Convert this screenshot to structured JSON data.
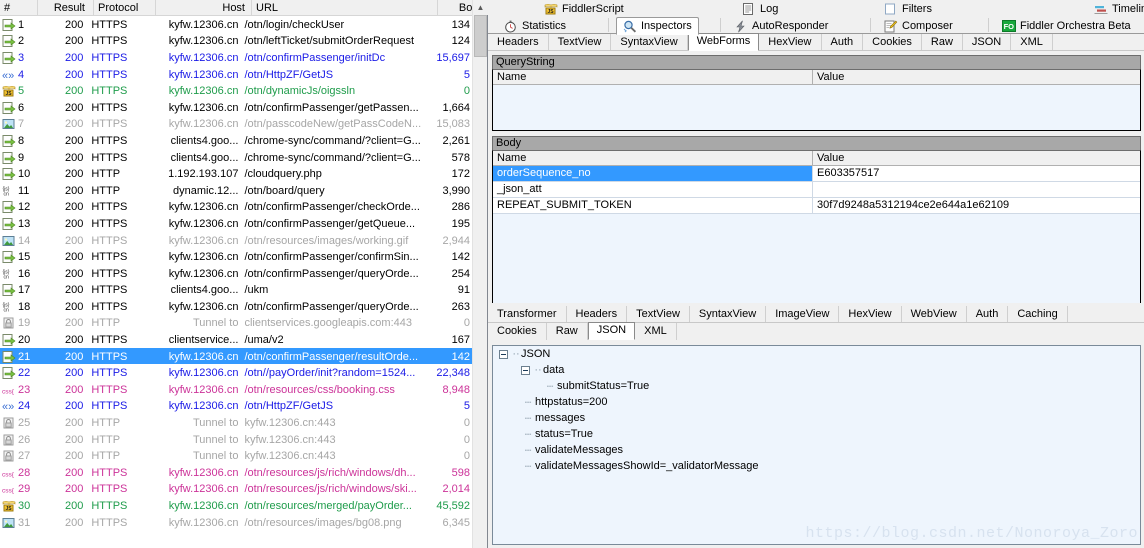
{
  "sessions": {
    "columns": [
      "#",
      "Result",
      "Protocol",
      "Host",
      "URL",
      "Body"
    ],
    "rows": [
      {
        "icon": "arrow-doc-icon",
        "num": "1",
        "result": "200",
        "protocol": "HTTPS",
        "host": "kyfw.12306.cn",
        "url": "/otn/login/checkUser",
        "body": "134",
        "style": "t-normal"
      },
      {
        "icon": "arrow-doc-icon",
        "num": "2",
        "result": "200",
        "protocol": "HTTPS",
        "host": "kyfw.12306.cn",
        "url": "/otn/leftTicket/submitOrderRequest",
        "body": "124",
        "style": "t-normal"
      },
      {
        "icon": "arrow-doc-icon",
        "num": "3",
        "result": "200",
        "protocol": "HTTPS",
        "host": "kyfw.12306.cn",
        "url": "/otn/confirmPassenger/initDc",
        "body": "15,697",
        "style": "t-blue"
      },
      {
        "icon": "angle-brackets-icon",
        "num": "4",
        "result": "200",
        "protocol": "HTTPS",
        "host": "kyfw.12306.cn",
        "url": "/otn/HttpZF/GetJS",
        "body": "5",
        "style": "t-blue"
      },
      {
        "icon": "js-script-icon",
        "num": "5",
        "result": "200",
        "protocol": "HTTPS",
        "host": "kyfw.12306.cn",
        "url": "/otn/dynamicJs/oigssln",
        "body": "0",
        "style": "t-green"
      },
      {
        "icon": "arrow-doc-icon",
        "num": "6",
        "result": "200",
        "protocol": "HTTPS",
        "host": "kyfw.12306.cn",
        "url": "/otn/confirmPassenger/getPassen...",
        "body": "1,664",
        "style": "t-normal"
      },
      {
        "icon": "image-icon",
        "num": "7",
        "result": "200",
        "protocol": "HTTPS",
        "host": "kyfw.12306.cn",
        "url": "/otn/passcodeNew/getPassCodeN...",
        "body": "15,083",
        "style": "t-gray"
      },
      {
        "icon": "arrow-doc-icon",
        "num": "8",
        "result": "200",
        "protocol": "HTTPS",
        "host": "clients4.goo...",
        "url": "/chrome-sync/command/?client=G...",
        "body": "2,261",
        "style": "t-normal"
      },
      {
        "icon": "arrow-doc-icon",
        "num": "9",
        "result": "200",
        "protocol": "HTTPS",
        "host": "clients4.goo...",
        "url": "/chrome-sync/command/?client=G...",
        "body": "578",
        "style": "t-normal"
      },
      {
        "icon": "arrow-doc-icon",
        "num": "10",
        "result": "200",
        "protocol": "HTTP",
        "host": "1.192.193.107",
        "url": "/cloudquery.php",
        "body": "172",
        "style": "t-normal"
      },
      {
        "icon": "jscn-icon",
        "num": "11",
        "result": "200",
        "protocol": "HTTP",
        "host": "dynamic.12...",
        "url": "/otn/board/query",
        "body": "3,990",
        "style": "t-normal"
      },
      {
        "icon": "arrow-doc-icon",
        "num": "12",
        "result": "200",
        "protocol": "HTTPS",
        "host": "kyfw.12306.cn",
        "url": "/otn/confirmPassenger/checkOrde...",
        "body": "286",
        "style": "t-normal"
      },
      {
        "icon": "arrow-doc-icon",
        "num": "13",
        "result": "200",
        "protocol": "HTTPS",
        "host": "kyfw.12306.cn",
        "url": "/otn/confirmPassenger/getQueue...",
        "body": "195",
        "style": "t-normal"
      },
      {
        "icon": "image-icon",
        "num": "14",
        "result": "200",
        "protocol": "HTTPS",
        "host": "kyfw.12306.cn",
        "url": "/otn/resources/images/working.gif",
        "body": "2,944",
        "style": "t-gray"
      },
      {
        "icon": "arrow-doc-icon",
        "num": "15",
        "result": "200",
        "protocol": "HTTPS",
        "host": "kyfw.12306.cn",
        "url": "/otn/confirmPassenger/confirmSin...",
        "body": "142",
        "style": "t-normal"
      },
      {
        "icon": "jscn-icon",
        "num": "16",
        "result": "200",
        "protocol": "HTTPS",
        "host": "kyfw.12306.cn",
        "url": "/otn/confirmPassenger/queryOrde...",
        "body": "254",
        "style": "t-normal"
      },
      {
        "icon": "arrow-doc-icon",
        "num": "17",
        "result": "200",
        "protocol": "HTTPS",
        "host": "clients4.goo...",
        "url": "/ukm",
        "body": "91",
        "style": "t-normal"
      },
      {
        "icon": "jscn-icon",
        "num": "18",
        "result": "200",
        "protocol": "HTTPS",
        "host": "kyfw.12306.cn",
        "url": "/otn/confirmPassenger/queryOrde...",
        "body": "263",
        "style": "t-normal"
      },
      {
        "icon": "lock-icon",
        "num": "19",
        "result": "200",
        "protocol": "HTTP",
        "host": "Tunnel to",
        "url": "clientservices.googleapis.com:443",
        "body": "0",
        "style": "t-gray"
      },
      {
        "icon": "arrow-doc-icon",
        "num": "20",
        "result": "200",
        "protocol": "HTTPS",
        "host": "clientservice...",
        "url": "/uma/v2",
        "body": "167",
        "style": "t-normal"
      },
      {
        "icon": "arrow-doc-icon",
        "num": "21",
        "result": "200",
        "protocol": "HTTPS",
        "host": "kyfw.12306.cn",
        "url": "/otn/confirmPassenger/resultOrde...",
        "body": "142",
        "style": "t-blue",
        "selected": true
      },
      {
        "icon": "arrow-doc-icon",
        "num": "22",
        "result": "200",
        "protocol": "HTTPS",
        "host": "kyfw.12306.cn",
        "url": "/otn//payOrder/init?random=1524...",
        "body": "22,348",
        "style": "t-blue"
      },
      {
        "icon": "css-icon",
        "num": "23",
        "result": "200",
        "protocol": "HTTPS",
        "host": "kyfw.12306.cn",
        "url": "/otn/resources/css/booking.css",
        "body": "8,948",
        "style": "t-pink"
      },
      {
        "icon": "angle-brackets-icon",
        "num": "24",
        "result": "200",
        "protocol": "HTTPS",
        "host": "kyfw.12306.cn",
        "url": "/otn/HttpZF/GetJS",
        "body": "5",
        "style": "t-blue"
      },
      {
        "icon": "lock-icon",
        "num": "25",
        "result": "200",
        "protocol": "HTTP",
        "host": "Tunnel to",
        "url": "kyfw.12306.cn:443",
        "body": "0",
        "style": "t-gray"
      },
      {
        "icon": "lock-icon",
        "num": "26",
        "result": "200",
        "protocol": "HTTP",
        "host": "Tunnel to",
        "url": "kyfw.12306.cn:443",
        "body": "0",
        "style": "t-gray"
      },
      {
        "icon": "lock-icon",
        "num": "27",
        "result": "200",
        "protocol": "HTTP",
        "host": "Tunnel to",
        "url": "kyfw.12306.cn:443",
        "body": "0",
        "style": "t-gray"
      },
      {
        "icon": "css-icon",
        "num": "28",
        "result": "200",
        "protocol": "HTTPS",
        "host": "kyfw.12306.cn",
        "url": "/otn/resources/js/rich/windows/dh...",
        "body": "598",
        "style": "t-pink"
      },
      {
        "icon": "css-icon",
        "num": "29",
        "result": "200",
        "protocol": "HTTPS",
        "host": "kyfw.12306.cn",
        "url": "/otn/resources/js/rich/windows/ski...",
        "body": "2,014",
        "style": "t-pink"
      },
      {
        "icon": "js-script-icon",
        "num": "30",
        "result": "200",
        "protocol": "HTTPS",
        "host": "kyfw.12306.cn",
        "url": "/otn/resources/merged/payOrder...",
        "body": "45,592",
        "style": "t-green"
      },
      {
        "icon": "image-icon",
        "num": "31",
        "result": "200",
        "protocol": "HTTPS",
        "host": "kyfw.12306.cn",
        "url": "/otn/resources/images/bg08.png",
        "body": "6,345",
        "style": "t-gray"
      }
    ]
  },
  "main_tabs": {
    "row1": [
      {
        "label": "FiddlerScript",
        "icon": "js-script-icon",
        "active": false
      },
      {
        "label": "Log",
        "icon": "log-icon",
        "active": false
      },
      {
        "label": "Filters",
        "icon": "filters-icon",
        "active": false
      },
      {
        "label": "Timeline",
        "icon": "timeline-icon",
        "active": false
      }
    ],
    "row2": [
      {
        "label": "Statistics",
        "icon": "stopwatch-icon",
        "active": false
      },
      {
        "label": "Inspectors",
        "icon": "magnifier-icon",
        "active": true
      },
      {
        "label": "AutoResponder",
        "icon": "lightning-icon",
        "active": false
      },
      {
        "label": "Composer",
        "icon": "compose-icon",
        "active": false
      },
      {
        "label": "Fiddler Orchestra Beta",
        "icon": "fo-badge-icon",
        "active": false
      }
    ]
  },
  "request_tabs": [
    {
      "label": "Headers",
      "active": false
    },
    {
      "label": "TextView",
      "active": false
    },
    {
      "label": "SyntaxView",
      "active": false
    },
    {
      "label": "WebForms",
      "active": true
    },
    {
      "label": "HexView",
      "active": false
    },
    {
      "label": "Auth",
      "active": false
    },
    {
      "label": "Cookies",
      "active": false
    },
    {
      "label": "Raw",
      "active": false
    },
    {
      "label": "JSON",
      "active": false
    },
    {
      "label": "XML",
      "active": false
    }
  ],
  "querystring": {
    "title": "QueryString",
    "headers": {
      "name": "Name",
      "value": "Value"
    },
    "rows": []
  },
  "body": {
    "title": "Body",
    "headers": {
      "name": "Name",
      "value": "Value"
    },
    "rows": [
      {
        "name": "orderSequence_no",
        "value": "E603357517",
        "selected": true
      },
      {
        "name": "_json_att",
        "value": "",
        "selected": false
      },
      {
        "name": "REPEAT_SUBMIT_TOKEN",
        "value": "30f7d9248a5312194ce2e644a1e62109",
        "selected": false
      }
    ]
  },
  "response_tabs_row1": [
    {
      "label": "Transformer",
      "active": false
    },
    {
      "label": "Headers",
      "active": false
    },
    {
      "label": "TextView",
      "active": false
    },
    {
      "label": "SyntaxView",
      "active": false
    },
    {
      "label": "ImageView",
      "active": false
    },
    {
      "label": "HexView",
      "active": false
    },
    {
      "label": "WebView",
      "active": false
    },
    {
      "label": "Auth",
      "active": false
    },
    {
      "label": "Caching",
      "active": false
    }
  ],
  "response_tabs_row2": [
    {
      "label": "Cookies",
      "active": false
    },
    {
      "label": "Raw",
      "active": false
    },
    {
      "label": "JSON",
      "active": true
    },
    {
      "label": "XML",
      "active": false
    }
  ],
  "json_tree": [
    {
      "label": "JSON",
      "depth": 0,
      "expander": true
    },
    {
      "label": "data",
      "depth": 1,
      "expander": true
    },
    {
      "label": "submitStatus=True",
      "depth": 2,
      "expander": false
    },
    {
      "label": "httpstatus=200",
      "depth": 1,
      "expander": false
    },
    {
      "label": "messages",
      "depth": 1,
      "expander": false
    },
    {
      "label": "status=True",
      "depth": 1,
      "expander": false
    },
    {
      "label": "validateMessages",
      "depth": 1,
      "expander": false
    },
    {
      "label": "validateMessagesShowId=_validatorMessage",
      "depth": 1,
      "expander": false
    }
  ],
  "watermark": "https://blog.csdn.net/Nonoroya_Zoro",
  "colors": {
    "selection": "#3399ff",
    "link_blue": "#1a1ae6",
    "script_green": "#1f9c4b",
    "css_pink": "#cc3399",
    "dim_gray": "#a6a6a6",
    "group_header": "#a8a8a8",
    "grid_bg": "#eef5fd"
  }
}
